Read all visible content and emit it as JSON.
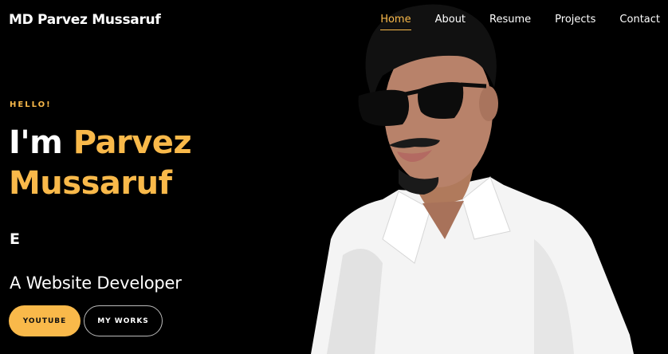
{
  "header": {
    "brand": "MD Parvez Mussaruf",
    "nav": [
      {
        "label": "Home",
        "active": true
      },
      {
        "label": "About",
        "active": false
      },
      {
        "label": "Resume",
        "active": false
      },
      {
        "label": "Projects",
        "active": false
      },
      {
        "label": "Contact",
        "active": false
      }
    ]
  },
  "hero": {
    "greeting": "HELLO!",
    "title_prefix": "I'm ",
    "name_first": "Parvez",
    "name_last": "Mussaruf",
    "typed_text": "E",
    "subtitle": "A Website Developer",
    "buttons": {
      "primary": "YOUTUBE",
      "secondary": "MY WORKS"
    }
  },
  "colors": {
    "accent": "#f9b94a",
    "background": "#000000",
    "text": "#ffffff"
  }
}
